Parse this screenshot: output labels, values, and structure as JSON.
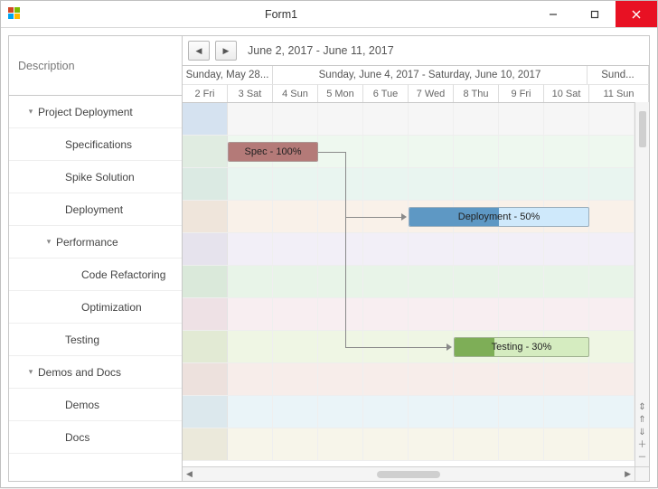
{
  "window": {
    "title": "Form1"
  },
  "leftHeader": "Description",
  "tree": {
    "items": [
      {
        "label": "Project Deployment",
        "indent": 18,
        "caret": true
      },
      {
        "label": "Specifications",
        "indent": 48,
        "caret": false
      },
      {
        "label": "Spike Solution",
        "indent": 48,
        "caret": false
      },
      {
        "label": "Deployment",
        "indent": 48,
        "caret": false
      },
      {
        "label": "Performance",
        "indent": 38,
        "caret": true
      },
      {
        "label": "Code Refactoring",
        "indent": 66,
        "caret": false
      },
      {
        "label": "Optimization",
        "indent": 66,
        "caret": false
      },
      {
        "label": "Testing",
        "indent": 48,
        "caret": false
      },
      {
        "label": "Demos and Docs",
        "indent": 18,
        "caret": true
      },
      {
        "label": "Demos",
        "indent": 48,
        "caret": false
      },
      {
        "label": "Docs",
        "indent": 48,
        "caret": false
      }
    ]
  },
  "toolbar": {
    "rangeLabel": "June 2, 2017 - June 11, 2017"
  },
  "header": {
    "topGroups": [
      "Sunday, May 28...",
      "Sunday, June 4, 2017 - Saturday, June 10, 2017",
      "Sund..."
    ],
    "days": [
      "2 Fri",
      "3 Sat",
      "4 Sun",
      "5 Mon",
      "6 Tue",
      "7 Wed",
      "8 Thu",
      "9 Fri",
      "10 Sat",
      "11 Sun"
    ]
  },
  "bars": {
    "spec": {
      "label": "Spec - 100%"
    },
    "deploy": {
      "label": "Deployment - 50%"
    },
    "test": {
      "label": "Testing - 30%"
    }
  },
  "chart_data": {
    "type": "bar",
    "title": "Gantt",
    "date_range": {
      "start": "2017-06-02",
      "end": "2017-06-11"
    },
    "tasks": [
      {
        "name": "Spec",
        "row": "Specifications",
        "start": "2017-06-03",
        "end": "2017-06-04",
        "progress_pct": 100,
        "successors": [
          "Deployment",
          "Testing"
        ]
      },
      {
        "name": "Deployment",
        "row": "Deployment",
        "start": "2017-06-07",
        "end": "2017-06-10",
        "progress_pct": 50
      },
      {
        "name": "Testing",
        "row": "Testing",
        "start": "2017-06-08",
        "end": "2017-06-10",
        "progress_pct": 30
      }
    ]
  }
}
